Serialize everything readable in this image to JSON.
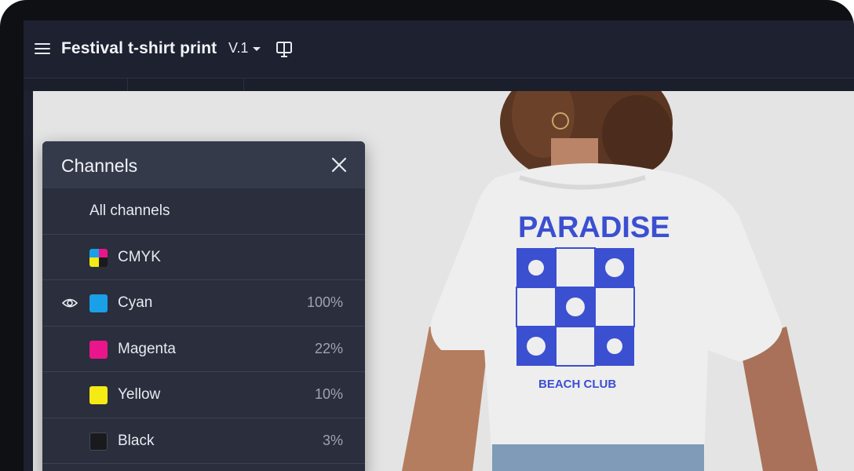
{
  "header": {
    "title": "Festival t-shirt print",
    "version": "V.1"
  },
  "artwork": {
    "headline": "PARADISE",
    "tagline": "BEACH CLUB",
    "ink_color": "#3b4fd1"
  },
  "channels_panel": {
    "title": "Channels",
    "all_label": "All channels",
    "rows": [
      {
        "label": "CMYK",
        "percent": "",
        "swatch": "cmyk-icon",
        "visible": false
      },
      {
        "label": "Cyan",
        "percent": "100%",
        "swatch_color": "#1aa0e6",
        "visible": true
      },
      {
        "label": "Magenta",
        "percent": "22%",
        "swatch_color": "#e8168a",
        "visible": false
      },
      {
        "label": "Yellow",
        "percent": "10%",
        "swatch_color": "#f5ea14",
        "visible": false
      },
      {
        "label": "Black",
        "percent": "3%",
        "swatch_color": "#1a1a1c",
        "visible": false
      }
    ]
  },
  "colors": {
    "app_bg": "#1d2130",
    "panel_bg": "#2a2e3d",
    "canvas_bg": "#e4e4e4"
  }
}
